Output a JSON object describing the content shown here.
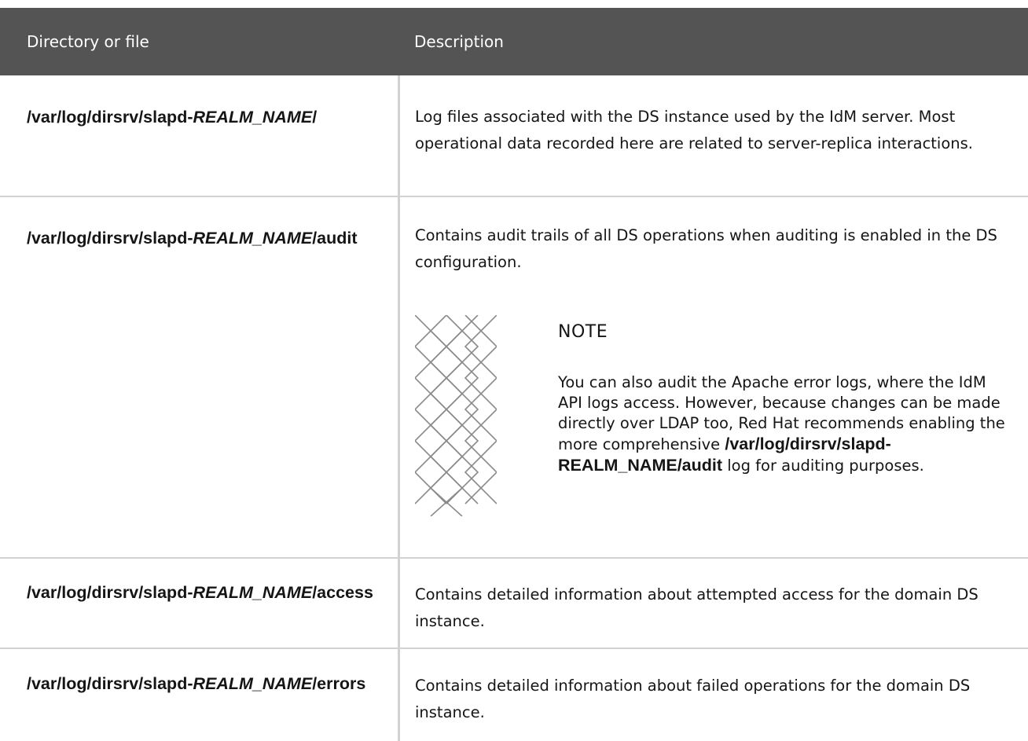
{
  "table": {
    "headers": {
      "path": "Directory or file",
      "description": "Description"
    },
    "rows": [
      {
        "path_prefix": "/var/log/dirsrv/slapd-",
        "path_var": "REALM_NAME",
        "path_suffix": "/",
        "description": "Log files associated with the DS instance used by the IdM server. Most operational data recorded here are related to server-replica interactions."
      },
      {
        "path_prefix": "/var/log/dirsrv/slapd-",
        "path_var": "REALM_NAME",
        "path_suffix": "/audit",
        "description": "Contains audit trails of all DS operations when auditing is enabled in the DS configuration.",
        "note": {
          "title": "NOTE",
          "body_text": "You can also audit the Apache error logs, where the IdM API logs access. However, because changes can be made directly over LDAP too, Red Hat recommends enabling the more comprehensive",
          "body_code": "/var/log/dirsrv/slapd-REALM_NAME/audit",
          "body_tail": "log for auditing purposes."
        }
      },
      {
        "path_prefix": "/var/log/dirsrv/slapd-",
        "path_var": "REALM_NAME",
        "path_suffix": "/access",
        "description": "Contains detailed information about attempted access for the domain DS instance."
      },
      {
        "path_prefix": "/var/log/dirsrv/slapd-",
        "path_var": "REALM_NAME",
        "path_suffix": "/errors",
        "description": "Contains detailed information about failed operations for the domain DS instance."
      }
    ]
  },
  "icons": {
    "note": "note-pattern-icon"
  },
  "colors": {
    "header_bg": "#545454",
    "header_text": "#ffffff",
    "text": "#151515",
    "grid": "#d2d2d2"
  }
}
